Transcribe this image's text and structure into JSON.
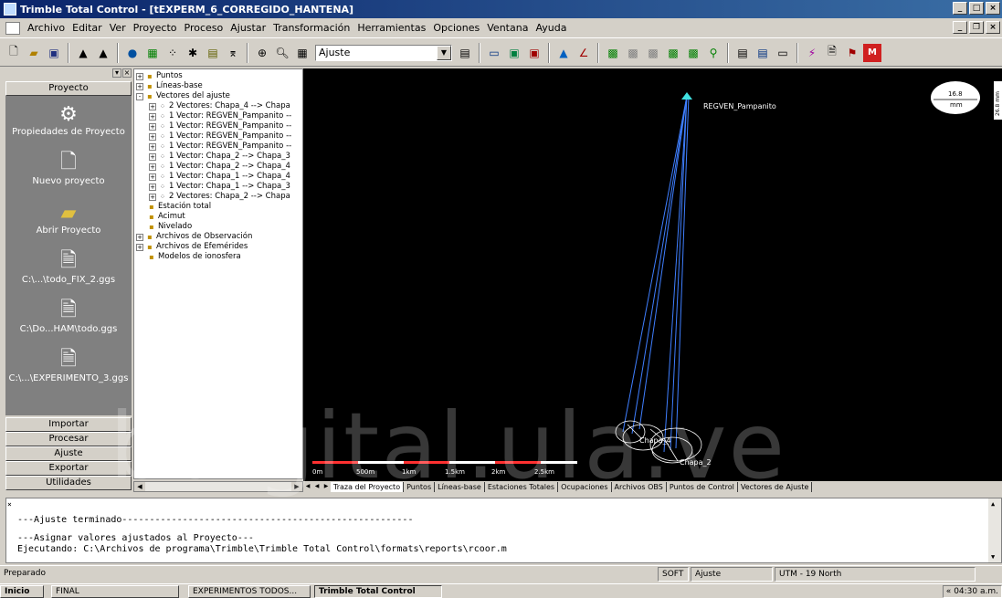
{
  "window": {
    "title": "Trimble Total Control - [tEXPERM_6_CORREGIDO_HANTENA]",
    "min": "_",
    "max": "□",
    "close": "×"
  },
  "menu": [
    "Archivo",
    "Editar",
    "Ver",
    "Proyecto",
    "Proceso",
    "Ajustar",
    "Transformación",
    "Herramientas",
    "Opciones",
    "Ventana",
    "Ayuda"
  ],
  "toolbar": {
    "combo_value": "Ajuste"
  },
  "left_panel": {
    "header": "Proyecto",
    "items": [
      {
        "label": "Propiedades de Proyecto",
        "icon": "gear-icon"
      },
      {
        "label": "Nuevo proyecto",
        "icon": "document-icon"
      },
      {
        "label": "Abrir Proyecto",
        "icon": "folder-icon"
      },
      {
        "label": "C:\\...\\todo_FIX_2.ggs",
        "icon": "file-icon"
      },
      {
        "label": "C:\\Do...HAM\\todo.ggs",
        "icon": "file-icon"
      },
      {
        "label": "C:\\...\\EXPERIMENTO_3.ggs",
        "icon": "file-icon"
      }
    ],
    "bottom_buttons": [
      "Importar",
      "Procesar",
      "Ajuste",
      "Exportar",
      "Utilidades"
    ]
  },
  "tree": [
    {
      "text": "Puntos",
      "exp": "+",
      "indent": 0
    },
    {
      "text": "Líneas-base",
      "exp": "+",
      "indent": 0
    },
    {
      "text": "Vectores del ajuste",
      "exp": "-",
      "indent": 0
    },
    {
      "text": "2 Vectores: Chapa_4 --> Chapa",
      "exp": "+",
      "indent": 1
    },
    {
      "text": "1 Vector: REGVEN_Pampanito --",
      "exp": "+",
      "indent": 1
    },
    {
      "text": "1 Vector: REGVEN_Pampanito --",
      "exp": "+",
      "indent": 1
    },
    {
      "text": "1 Vector: REGVEN_Pampanito --",
      "exp": "+",
      "indent": 1
    },
    {
      "text": "1 Vector: REGVEN_Pampanito --",
      "exp": "+",
      "indent": 1
    },
    {
      "text": "1 Vector: Chapa_2 --> Chapa_3",
      "exp": "+",
      "indent": 1
    },
    {
      "text": "1 Vector: Chapa_2 --> Chapa_4",
      "exp": "+",
      "indent": 1
    },
    {
      "text": "1 Vector: Chapa_1 --> Chapa_4",
      "exp": "+",
      "indent": 1
    },
    {
      "text": "1 Vector: Chapa_1 --> Chapa_3",
      "exp": "+",
      "indent": 1
    },
    {
      "text": "2 Vectores: Chapa_2 --> Chapa",
      "exp": "+",
      "indent": 1
    },
    {
      "text": "Estación total",
      "exp": "",
      "indent": 0
    },
    {
      "text": "Acimut",
      "exp": "",
      "indent": 0
    },
    {
      "text": "Nivelado",
      "exp": "",
      "indent": 0
    },
    {
      "text": "Archivos de Observación",
      "exp": "+",
      "indent": 0
    },
    {
      "text": "Archivos de Efemérides",
      "exp": "+",
      "indent": 0
    },
    {
      "text": "Modelos de ionosfera",
      "exp": "",
      "indent": 0
    }
  ],
  "map": {
    "station_label": "REGVEN_Pampanito",
    "cluster_label_1": "Chapa_4",
    "cluster_label_2": "Chapa_2",
    "scale_labels": [
      "0m",
      "500m",
      "1km",
      "1.5km",
      "2km",
      "2.5km"
    ],
    "scale_readout": "16.8",
    "scale_unit": "mm",
    "side_readout": "26.8 mm"
  },
  "tabs": [
    "Traza del Proyecto",
    "Puntos",
    "Líneas-base",
    "Estaciones Totales",
    "Ocupaciones",
    "Archivos OBS",
    "Puntos de Control",
    "Vectores de Ajuste"
  ],
  "console": {
    "line1": "---Ajuste terminado-----------------------------------------------------",
    "line2": "---Asignar valores ajustados al Proyecto---",
    "line3": "Ejecutando: C:\\Archivos de programa\\Trimble\\Trimble Total Control\\formats\\reports\\rcoor.m"
  },
  "status": {
    "left": "Preparado",
    "mode": "SOFT",
    "stage": "Ajuste",
    "projection": "UTM - 19 North"
  },
  "taskbar": {
    "start": "Inicio",
    "tasks": [
      "FINAL",
      "EXPERIMENTOS TODOS...",
      "Trimble Total Control"
    ],
    "clock": "04:30 a.m."
  },
  "watermark": "bdigital.ula.ve",
  "colors": {
    "title_start": "#0a246a",
    "title_end": "#3a6ea5",
    "vector": "#3f7fff",
    "scale_red": "#ff3030"
  }
}
